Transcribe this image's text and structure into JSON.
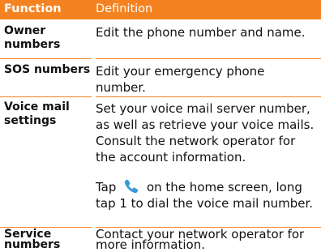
{
  "header": {
    "function": "Function",
    "definition": "Definition"
  },
  "rows": [
    {
      "function": "Owner numbers",
      "definition": "Edit the phone number and name."
    },
    {
      "function": "SOS numbers",
      "definition": "Edit your emergency phone number."
    },
    {
      "function": "Voice mail settings",
      "definition": "Set your voice mail server number, as well as retrieve your voice mails. Consult the network operator for the account information.",
      "note_before": "Tap",
      "note_after": "on the home screen, long tap 1 to dial the voice mail number.",
      "icon": "phone-handset-icon"
    },
    {
      "function": "Service numbers",
      "definition": "Contact your network operator for more information."
    }
  ],
  "colors": {
    "accent": "#f58220",
    "icon": "#3a9ad9"
  }
}
